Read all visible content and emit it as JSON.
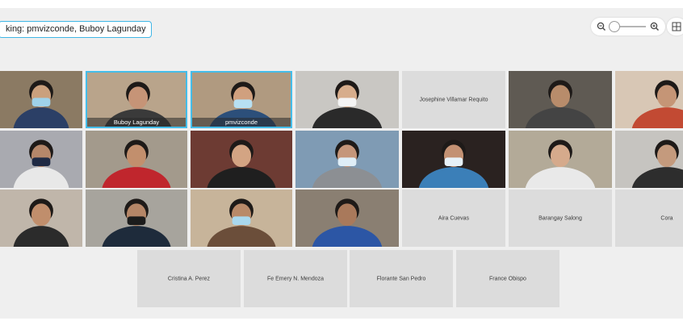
{
  "speaking": {
    "text": "king: pmvizconde, Buboy Lagunday"
  },
  "toolbar": {
    "zoom_out_icon": "zoom-out-icon",
    "zoom_in_icon": "zoom-in-icon",
    "layout_icon": "grid-layout-icon",
    "zoom_level": 0.1
  },
  "participants": [
    {
      "name": "",
      "video": true,
      "bg": "#8b7a63",
      "face": "#caa07d",
      "shirt": "#2b3f66",
      "mask": "#9fd2ea"
    },
    {
      "name": "Buboy Lagunday",
      "video": true,
      "bg": "#b9a48b",
      "face": "#c69477",
      "shirt": "#3a3a3a",
      "mask": "",
      "active": true,
      "caption": true
    },
    {
      "name": "pmvizconde",
      "video": true,
      "bg": "#b09a80",
      "face": "#d0a07e",
      "shirt": "#2c4f7a",
      "mask": "#b7e0f2",
      "active": true,
      "caption": true
    },
    {
      "name": "",
      "video": true,
      "bg": "#c9c7c3",
      "face": "#d7ad8c",
      "shirt": "#2a2a2a",
      "mask": "#f4f4f4"
    },
    {
      "name": "Josephine Villamar Requito",
      "video": false
    },
    {
      "name": "",
      "video": true,
      "bg": "#5f5a53",
      "face": "#b88c6b",
      "shirt": "#444444",
      "mask": ""
    },
    {
      "name": "",
      "video": true,
      "bg": "#d8c7b5",
      "face": "#c59576",
      "shirt": "#c24a33",
      "mask": ""
    },
    {
      "name": "",
      "video": true,
      "bg": "#a9aab0",
      "face": "#b5876a",
      "shirt": "#e8e8e8",
      "mask": "#1f2a44"
    },
    {
      "name": "",
      "video": true,
      "bg": "#a39a8c",
      "face": "#c28f6d",
      "shirt": "#c0262d",
      "mask": ""
    },
    {
      "name": "",
      "video": true,
      "bg": "#6d3b33",
      "face": "#d3a483",
      "shirt": "#1f1f1f",
      "mask": ""
    },
    {
      "name": "",
      "video": true,
      "bg": "#7f9bb4",
      "face": "#c5967a",
      "shirt": "#8c8f93",
      "mask": "#dfeef7"
    },
    {
      "name": "",
      "video": true,
      "bg": "#2a2220",
      "face": "#c39173",
      "shirt": "#3b7fb8",
      "mask": "#e7f1f8"
    },
    {
      "name": "",
      "video": true,
      "bg": "#b3aa98",
      "face": "#d5aa8c",
      "shirt": "#e9e9e9",
      "mask": ""
    },
    {
      "name": "",
      "video": true,
      "bg": "#c6c4c0",
      "face": "#c49a7d",
      "shirt": "#2d2d2d",
      "mask": ""
    },
    {
      "name": "",
      "video": true,
      "bg": "#c0b6aa",
      "face": "#c08e6c",
      "shirt": "#2b2b2b",
      "mask": ""
    },
    {
      "name": "",
      "video": true,
      "bg": "#a7a49d",
      "face": "#b58667",
      "shirt": "#1e2b3b",
      "mask": "#1c1c1c"
    },
    {
      "name": "",
      "video": true,
      "bg": "#c7b49a",
      "face": "#b98a69",
      "shirt": "#6b4e3a",
      "mask": "#a9d8ee"
    },
    {
      "name": "",
      "video": true,
      "bg": "#8a7f72",
      "face": "#a9795b",
      "shirt": "#2c56a5",
      "mask": ""
    },
    {
      "name": "Aira Cuevas",
      "video": false
    },
    {
      "name": "Barangay Salong",
      "video": false
    },
    {
      "name": "Cora",
      "video": false
    },
    {
      "name": "Cristina A. Perez",
      "video": false
    },
    {
      "name": "Fe Emery N. Mendoza",
      "video": false
    },
    {
      "name": "Florante San Pedro",
      "video": false
    },
    {
      "name": "France Obispo",
      "video": false
    }
  ]
}
